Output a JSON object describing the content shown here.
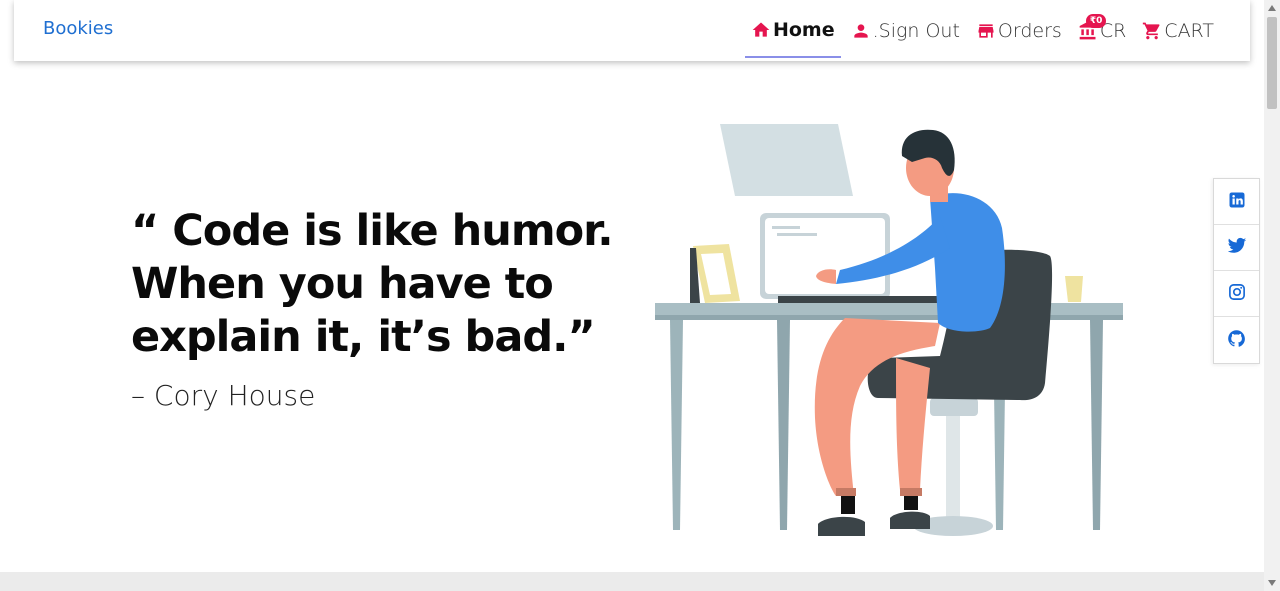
{
  "nav": {
    "brand": "Bookies",
    "items": [
      {
        "label": "Home",
        "icon": "home-icon",
        "active": true
      },
      {
        "label": ".Sign Out",
        "icon": "person-icon"
      },
      {
        "label": "Orders",
        "icon": "store-icon"
      },
      {
        "label": "CR",
        "icon": "bank-icon",
        "badge": "₹0"
      },
      {
        "label": "CART",
        "icon": "cart-icon"
      }
    ]
  },
  "hero": {
    "quote": "“ Code is like humor. When you have to explain it, it’s bad.”",
    "author": "– Cory House"
  },
  "social": [
    "linkedin-icon",
    "twitter-icon",
    "instagram-icon",
    "github-icon"
  ],
  "colors": {
    "brand": "#1f6fd1",
    "accent": "#e5154f",
    "social_icon": "#1769d6",
    "active_underline": "#8a8fe8"
  }
}
